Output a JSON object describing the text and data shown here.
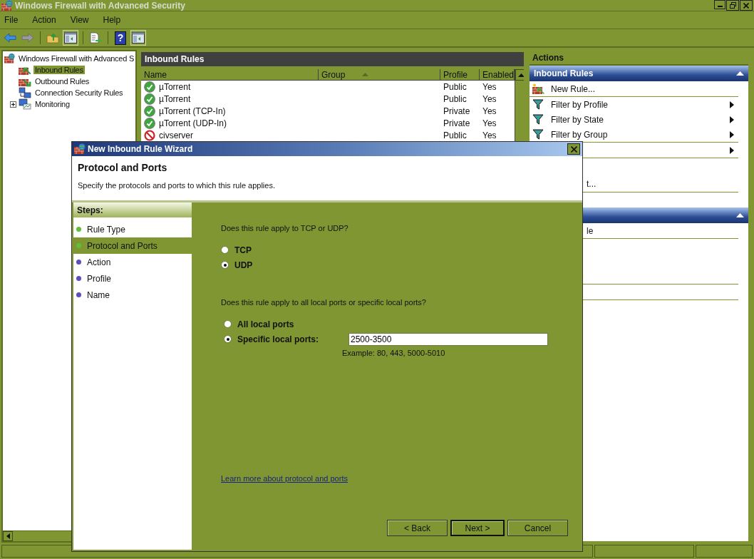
{
  "window": {
    "title": "Windows Firewall with Advanced Security"
  },
  "menu": [
    {
      "label": "File"
    },
    {
      "label": "Action"
    },
    {
      "label": "View"
    },
    {
      "label": "Help"
    }
  ],
  "toolbar": [
    {
      "kind": "back"
    },
    {
      "kind": "forward"
    },
    {
      "kind": "separator"
    },
    {
      "kind": "up"
    },
    {
      "kind": "pane",
      "pressed": true
    },
    {
      "kind": "separator"
    },
    {
      "kind": "export"
    },
    {
      "kind": "separator"
    },
    {
      "kind": "help",
      "glyph": "?"
    },
    {
      "kind": "pane",
      "pressed": true
    }
  ],
  "tree": {
    "label": "Windows Firewall with Advanced S",
    "kind": "firewall",
    "selected": false,
    "children": [
      {
        "label": "Inbound Rules",
        "kind": "inbound",
        "selected": true
      },
      {
        "label": "Outbound Rules",
        "kind": "outbound",
        "selected": false
      },
      {
        "label": "Connection Security Rules",
        "kind": "connection",
        "selected": false
      },
      {
        "label": "Monitoring",
        "kind": "monitor",
        "selected": false,
        "expanded": false
      }
    ]
  },
  "rules": {
    "title": "Inbound Rules",
    "columns": [
      {
        "label": "Name"
      },
      {
        "label": "Group",
        "sorted": true
      },
      {
        "label": "Profile"
      },
      {
        "label": "Enabled"
      }
    ],
    "rows": [
      {
        "kind": "allowed",
        "name": "µTorrent",
        "profile": "Public",
        "enabled": "Yes"
      },
      {
        "kind": "allowed",
        "name": "µTorrent",
        "profile": "Public",
        "enabled": "Yes"
      },
      {
        "kind": "allowed",
        "name": "µTorrent (TCP-In)",
        "profile": "Private",
        "enabled": "Yes"
      },
      {
        "kind": "allowed",
        "name": "µTorrent (UDP-In)",
        "profile": "Private",
        "enabled": "Yes"
      },
      {
        "kind": "blocked",
        "name": "civserver",
        "profile": "Public",
        "enabled": "Yes"
      }
    ]
  },
  "actions": {
    "title": "Actions",
    "sections": [
      {
        "title": "Inbound Rules",
        "expanded": true,
        "items": [
          {
            "kind": "new-rule",
            "label": "New Rule...",
            "separator": true
          },
          {
            "kind": "filter",
            "label": "Filter by Profile",
            "submenu": true
          },
          {
            "kind": "filter",
            "label": "Filter by State",
            "submenu": true
          },
          {
            "kind": "filter",
            "label": "Filter by Group",
            "submenu": true,
            "separator": true
          },
          {
            "kind": "hidden",
            "submenu": true,
            "separator": true
          },
          {
            "kind": "hidden",
            "label": "t...",
            "tall": true,
            "separator": true
          },
          {
            "kind": "hidden"
          }
        ]
      },
      {
        "expanded": true,
        "items": [
          {
            "kind": "hidden",
            "label": "le",
            "separator": true
          },
          {
            "kind": "hidden"
          },
          {
            "kind": "hidden"
          },
          {
            "kind": "hidden",
            "separator": true
          },
          {
            "kind": "hidden",
            "separator": true
          }
        ]
      }
    ]
  },
  "wizard": {
    "title": "New Inbound Rule Wizard",
    "heading": "Protocol and Ports",
    "subtitle": "Specify the protocols and ports to which this rule applies.",
    "steps_title": "Steps:",
    "steps": [
      {
        "label": "Rule Type",
        "selected": false,
        "color": "#5fbf3a"
      },
      {
        "label": "Protocol and Ports",
        "selected": true,
        "color": "#5fbf3a"
      },
      {
        "label": "Action",
        "selected": false,
        "color": "#5a4fc0"
      },
      {
        "label": "Profile",
        "selected": false,
        "color": "#5a4fc0"
      },
      {
        "label": "Name",
        "selected": false,
        "color": "#5a4fc0"
      }
    ],
    "protocol_question": "Does this rule apply to TCP or UDP?",
    "protocols": [
      {
        "label": "TCP",
        "selected": false
      },
      {
        "label": "UDP",
        "selected": true
      }
    ],
    "ports_question": "Does this rule apply to all local ports or specific local ports?",
    "ports": [
      {
        "label": "All local ports",
        "selected": false
      },
      {
        "label": "Specific local ports:",
        "selected": true
      }
    ],
    "ports_value": "2500-3500",
    "ports_example": "Example: 80, 443, 5000-5010",
    "link": "Learn more about protocol and ports",
    "buttons": [
      {
        "label": "< Back",
        "default": false
      },
      {
        "label": "Next >",
        "default": true
      },
      {
        "label": "Cancel",
        "default": false
      }
    ]
  }
}
